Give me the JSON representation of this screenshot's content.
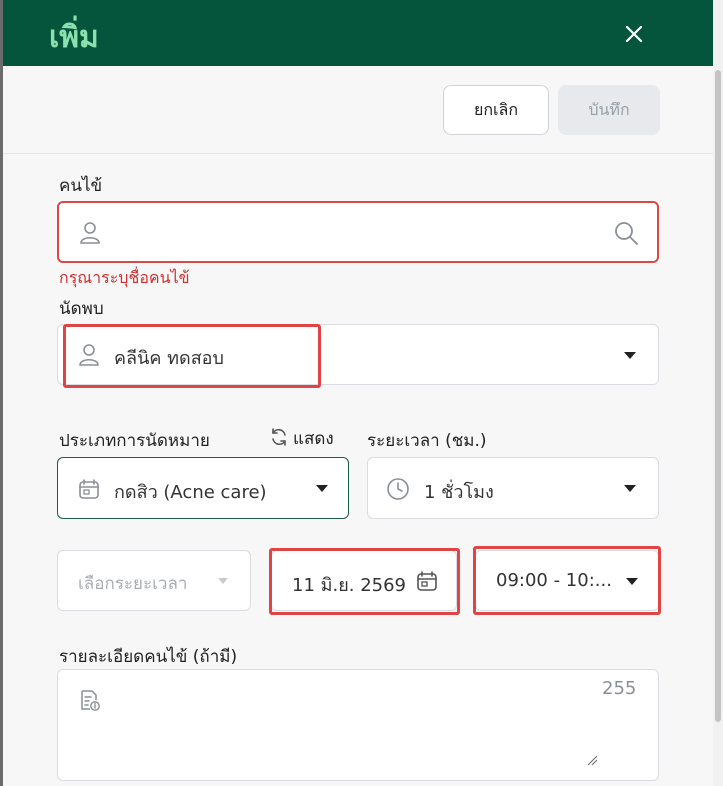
{
  "header": {
    "title": "เพิ่ม",
    "close_icon": "close-icon"
  },
  "actions": {
    "cancel_label": "ยกเลิก",
    "save_label": "บันทึก"
  },
  "patient": {
    "label": "คนไข้",
    "value": "",
    "error": "กรุณาระบุชื่อคนไข้",
    "icons": [
      "person-icon",
      "search-icon"
    ]
  },
  "appointment": {
    "label": "นัดพบ",
    "value": "คลีนิค ทดสอบ"
  },
  "appointment_type": {
    "label": "ประเภทการนัดหมาย",
    "refresh_label": "แสดง",
    "value": "กดสิว (Acne care)"
  },
  "duration": {
    "label": "ระยะเวลา (ชม.)",
    "value": "1 ชั่วโมง"
  },
  "period": {
    "placeholder": "เลือกระยะเวลา"
  },
  "date": {
    "value": "11 มิ.ย. 2569"
  },
  "time": {
    "value": "09:00 - 10:..."
  },
  "details": {
    "label": "รายละเอียดคนไข้ (ถ้ามี)",
    "counter": "255"
  },
  "colors": {
    "header_bg": "#05553c",
    "title": "#8ce0ae",
    "error": "#d94848",
    "highlight": "#e04545"
  }
}
